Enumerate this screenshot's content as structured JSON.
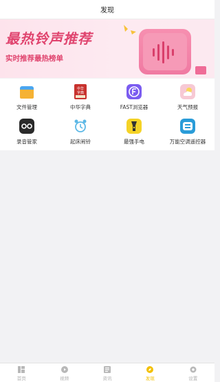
{
  "header": {
    "title": "发现"
  },
  "banner": {
    "title": "最热铃声推荐",
    "subtitle": "实时推荐最热榜单"
  },
  "grid": {
    "rows": [
      [
        {
          "label": "文件管理",
          "icon": "folder-icon",
          "color": "#4aa6f0"
        },
        {
          "label": "中华字典",
          "icon": "dictionary-icon",
          "color": "#c8322e"
        },
        {
          "label": "FAST浏览器",
          "icon": "browser-icon",
          "color": "#7b5cf0"
        },
        {
          "label": "天气预报",
          "icon": "weather-icon",
          "color": "#f4b7c6"
        }
      ],
      [
        {
          "label": "录音管家",
          "icon": "recorder-icon",
          "color": "#2a2a2a"
        },
        {
          "label": "起床闹铃",
          "icon": "alarm-clock-icon",
          "color": "#5cb8e6"
        },
        {
          "label": "最强手电",
          "icon": "flashlight-icon",
          "color": "#f5d327"
        },
        {
          "label": "万能空调遥控器",
          "icon": "remote-control-icon",
          "color": "#2a9cd8"
        }
      ]
    ]
  },
  "tabbar": {
    "items": [
      {
        "label": "首页",
        "icon": "home-icon"
      },
      {
        "label": "视频",
        "icon": "video-icon"
      },
      {
        "label": "资讯",
        "icon": "news-icon"
      },
      {
        "label": "发现",
        "icon": "discover-icon",
        "active": true
      },
      {
        "label": "设置",
        "icon": "settings-icon"
      }
    ]
  },
  "colors": {
    "accent": "#f3c000",
    "banner_text": "#e0456f",
    "background": "#f2f2f4"
  }
}
